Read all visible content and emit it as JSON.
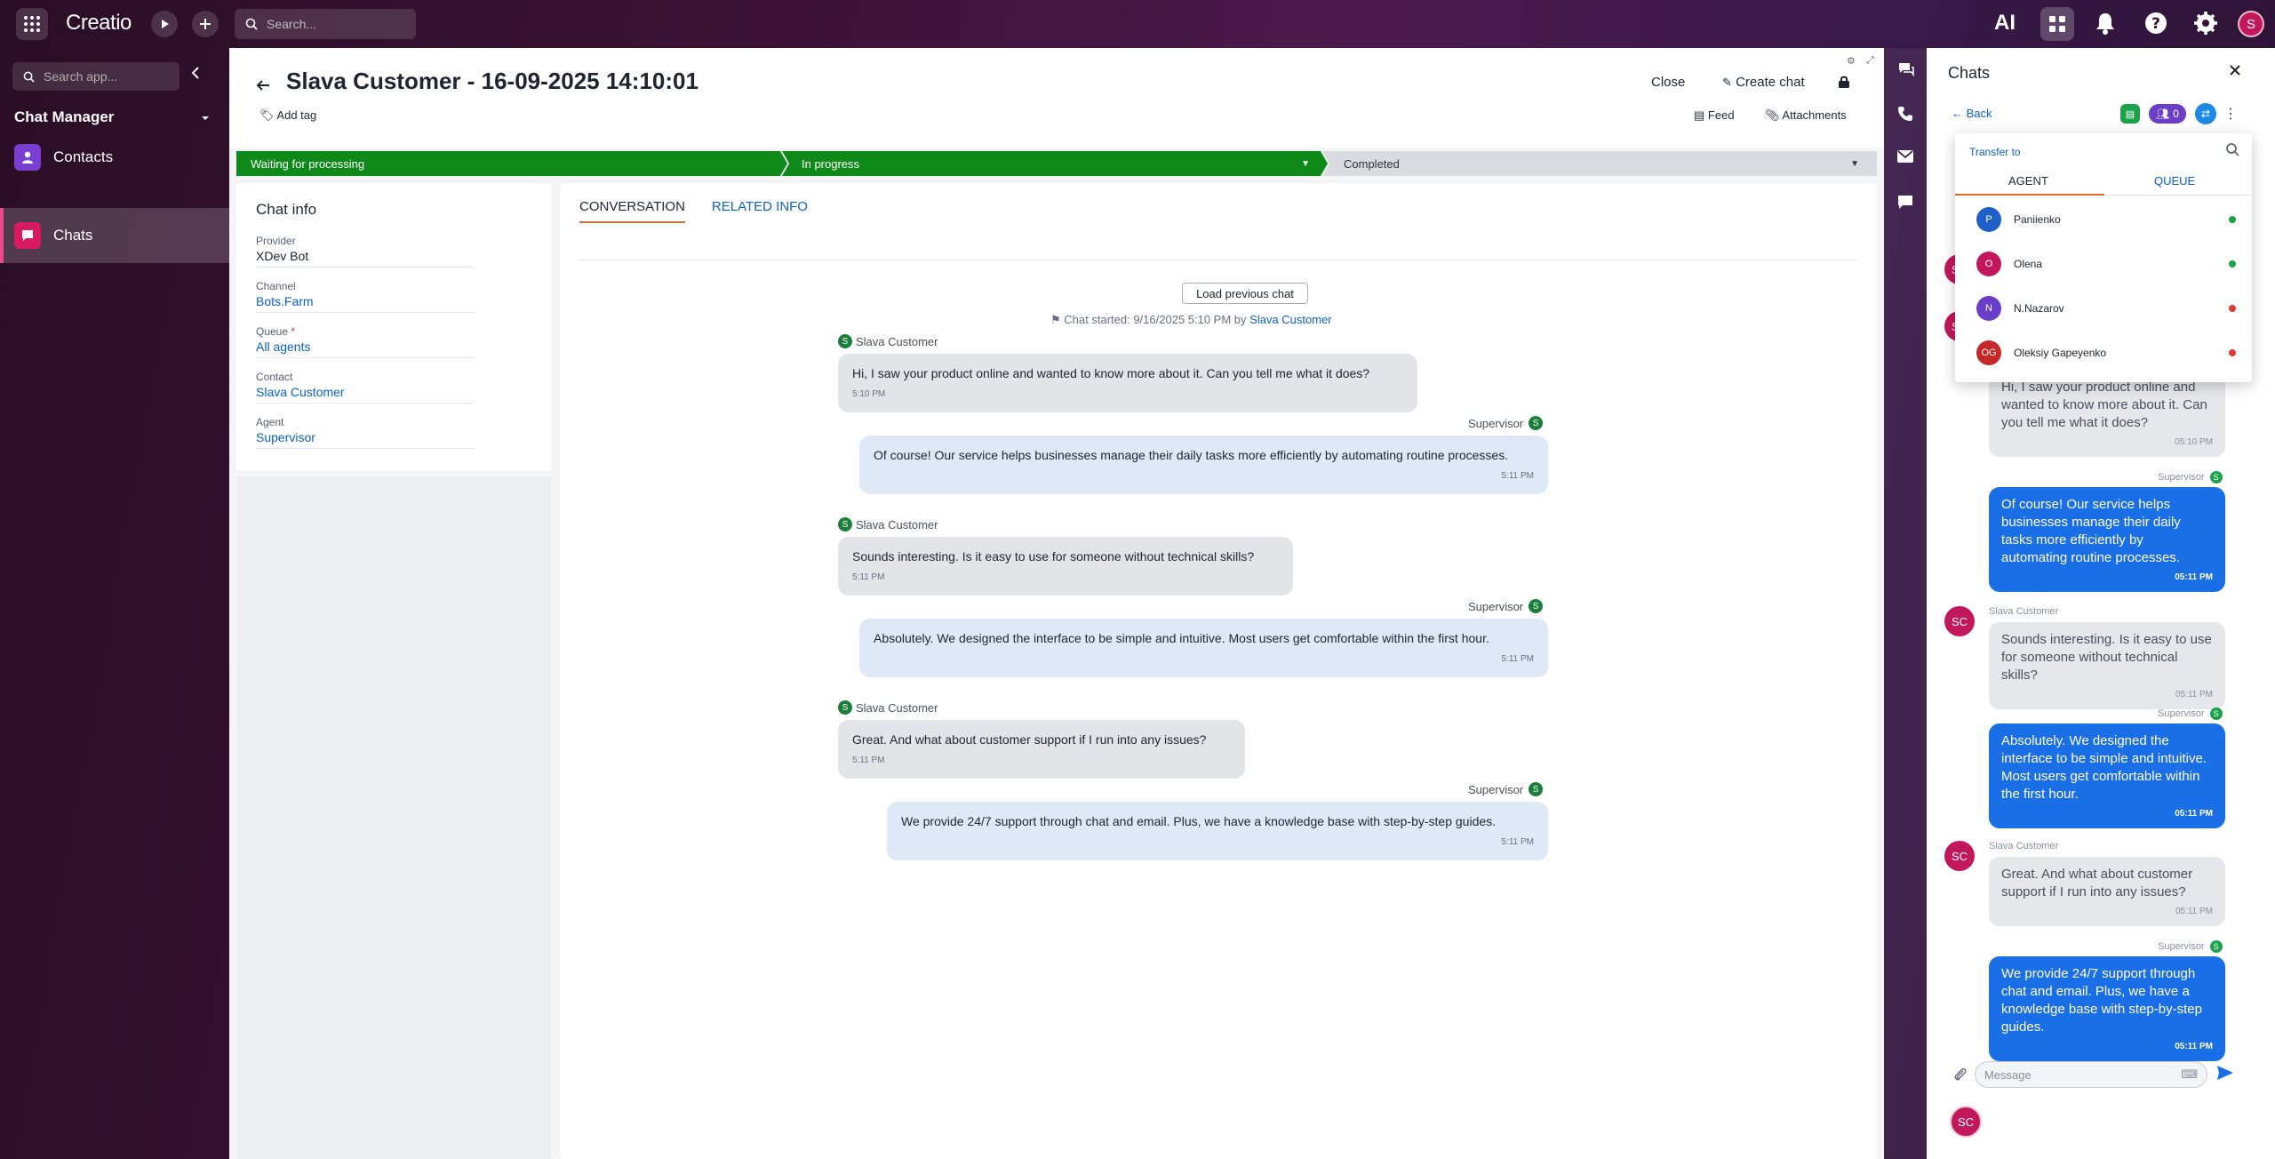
{
  "app": {
    "logo": "Creatio",
    "search_placeholder": "Search...",
    "ai_label": "AI",
    "user_initial": "S"
  },
  "nav": {
    "search_placeholder": "Search app...",
    "section": "Chat Manager",
    "items": [
      {
        "label": "Contacts",
        "icon": "contacts-icon"
      },
      {
        "label": "Chats",
        "icon": "chats-icon"
      }
    ]
  },
  "record": {
    "title": "Slava Customer - 16-09-2025 14:10:01",
    "add_tag": "Add tag",
    "close": "Close",
    "create_chat": "Create chat",
    "feed": "Feed",
    "attachments": "Attachments"
  },
  "stages": [
    {
      "label": "Waiting for processing",
      "state": "done"
    },
    {
      "label": "In progress",
      "state": "current"
    },
    {
      "label": "Completed",
      "state": "pending"
    }
  ],
  "chat_info": {
    "title": "Chat info",
    "fields": [
      {
        "label": "Provider",
        "value": "XDev Bot"
      },
      {
        "label": "Channel",
        "value": "Bots.Farm"
      },
      {
        "label": "Queue",
        "value": "All agents"
      },
      {
        "label": "Contact",
        "value": "Slava Customer"
      },
      {
        "label": "Agent",
        "value": "Supervisor"
      }
    ],
    "required_mark": "*"
  },
  "conversation": {
    "tabs": [
      "CONVERSATION",
      "RELATED INFO"
    ],
    "load_previous": "Load previous chat",
    "started_prefix": "Chat started: 9/16/2025 5:10 PM by",
    "started_by": "Slava Customer",
    "messages": [
      {
        "sender": "Slava Customer",
        "text": "Hi, I saw your product online and wanted to know more about it. Can you tell me what it does?",
        "time": "5:10 PM"
      },
      {
        "sender": "Supervisor",
        "text": "Of course! Our service helps businesses manage their daily tasks more efficiently by automating routine processes.",
        "time": "5:11 PM"
      },
      {
        "sender": "Slava Customer",
        "text": "Sounds interesting. Is it easy to use for someone without technical skills?",
        "time": "5:11 PM"
      },
      {
        "sender": "Supervisor",
        "text": "Absolutely. We designed the interface to be simple and intuitive. Most users get comfortable within the first hour.",
        "time": "5:11 PM"
      },
      {
        "sender": "Slava Customer",
        "text": "Great. And what about customer support if I run into any issues?",
        "time": "5:11 PM"
      },
      {
        "sender": "Supervisor",
        "text": "We provide 24/7 support through chat and email. Plus, we have a knowledge base with step-by-step guides.",
        "time": "5:11 PM"
      }
    ],
    "avatar_letter": "S"
  },
  "chats_panel": {
    "title": "Chats",
    "back": "Back",
    "queue_count": "0",
    "transfer": {
      "label": "Transfer to",
      "tabs": [
        "AGENT",
        "QUEUE"
      ],
      "agents": [
        {
          "initials": "P",
          "name": "Paniienko",
          "color": "#1e5fc8",
          "status": "#16a34a"
        },
        {
          "initials": "O",
          "name": "Olena",
          "color": "#c2185b",
          "status": "#16a34a"
        },
        {
          "initials": "N",
          "name": "N.Nazarov",
          "color": "#6a3ec9",
          "status": "#e53935"
        },
        {
          "initials": "OG",
          "name": "Oleksiy Gapeyenko",
          "color": "#c62828",
          "status": "#e53935"
        }
      ]
    },
    "messages": [
      {
        "sender": "",
        "text": "Hi, I saw your product online and wanted to know more about it. Can you tell me what it does?",
        "time": "05:10 PM"
      },
      {
        "sender": "Supervisor",
        "text": "Of course! Our service helps businesses manage their daily tasks more efficiently by automating routine processes.",
        "time": "05:11 PM"
      },
      {
        "sender": "Slava Customer",
        "text": "Sounds interesting. Is it easy to use for someone without technical skills?",
        "time": "05:11 PM"
      },
      {
        "sender": "Supervisor",
        "text": "Absolutely. We designed the interface to be simple and intuitive. Most users get comfortable within the first hour.",
        "time": "05:11 PM"
      },
      {
        "sender": "Slava Customer",
        "text": "Great. And what about customer support if I run into any issues?",
        "time": "05:11 PM"
      },
      {
        "sender": "Supervisor",
        "text": "We provide 24/7 support through chat and email. Plus, we have a knowledge base with step-by-step guides.",
        "time": "05:11 PM"
      }
    ],
    "customer_initials": "SC",
    "supervisor_letter": "S",
    "message_placeholder": "Message",
    "me_initials": "SC"
  }
}
